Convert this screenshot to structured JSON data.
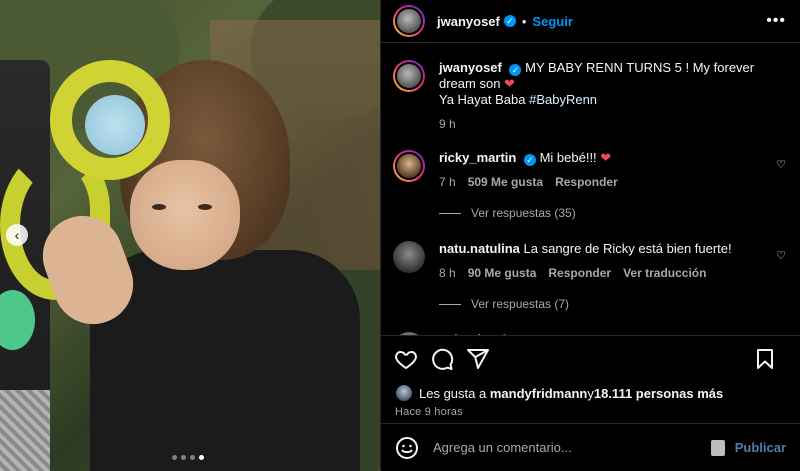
{
  "post": {
    "author": "jwanyosef",
    "follow_label": "Seguir",
    "separator": "•",
    "more_label": "•••",
    "caption_text": "MY BABY RENN TURNS 5 ! My forever dream son",
    "caption_heart": "❤",
    "caption_line2_text": "Ya Hayat Baba ",
    "caption_hashtag": "#BabyRenn",
    "caption_time": "9 h"
  },
  "photo": {
    "carousel_dots": 4,
    "active_dot": 3,
    "prev_label": "‹"
  },
  "comments": [
    {
      "user": "ricky_martin",
      "verified": true,
      "text": "Mi bebé!!!",
      "heart": "❤",
      "time": "7 h",
      "likes": "509 Me gusta",
      "reply_label": "Responder",
      "replies_label": "Ver respuestas (35)"
    },
    {
      "user": "natu.natulina",
      "verified": false,
      "text": "La sangre de Ricky está bien fuerte!",
      "time": "8 h",
      "likes": "90 Me gusta",
      "reply_label": "Responder",
      "translate_label": "Ver traducción",
      "replies_label": "Ver respuestas (7)"
    },
    {
      "user": "eglantinazingg",
      "verified": true,
      "text": "",
      "hearts": "❤ ❤"
    }
  ],
  "likes_summary": {
    "prefix": "Les gusta a ",
    "user": "mandyfridmann",
    "middle": " y ",
    "count": "18.111 personas más"
  },
  "post_time": "Hace 9 horas",
  "composer": {
    "placeholder": "Agrega un comentario...",
    "publish_label": "Publicar"
  },
  "colors": {
    "accent": "#0095f6",
    "heart": "#ed4956",
    "muted": "#a8a8a8",
    "background": "#000000"
  }
}
